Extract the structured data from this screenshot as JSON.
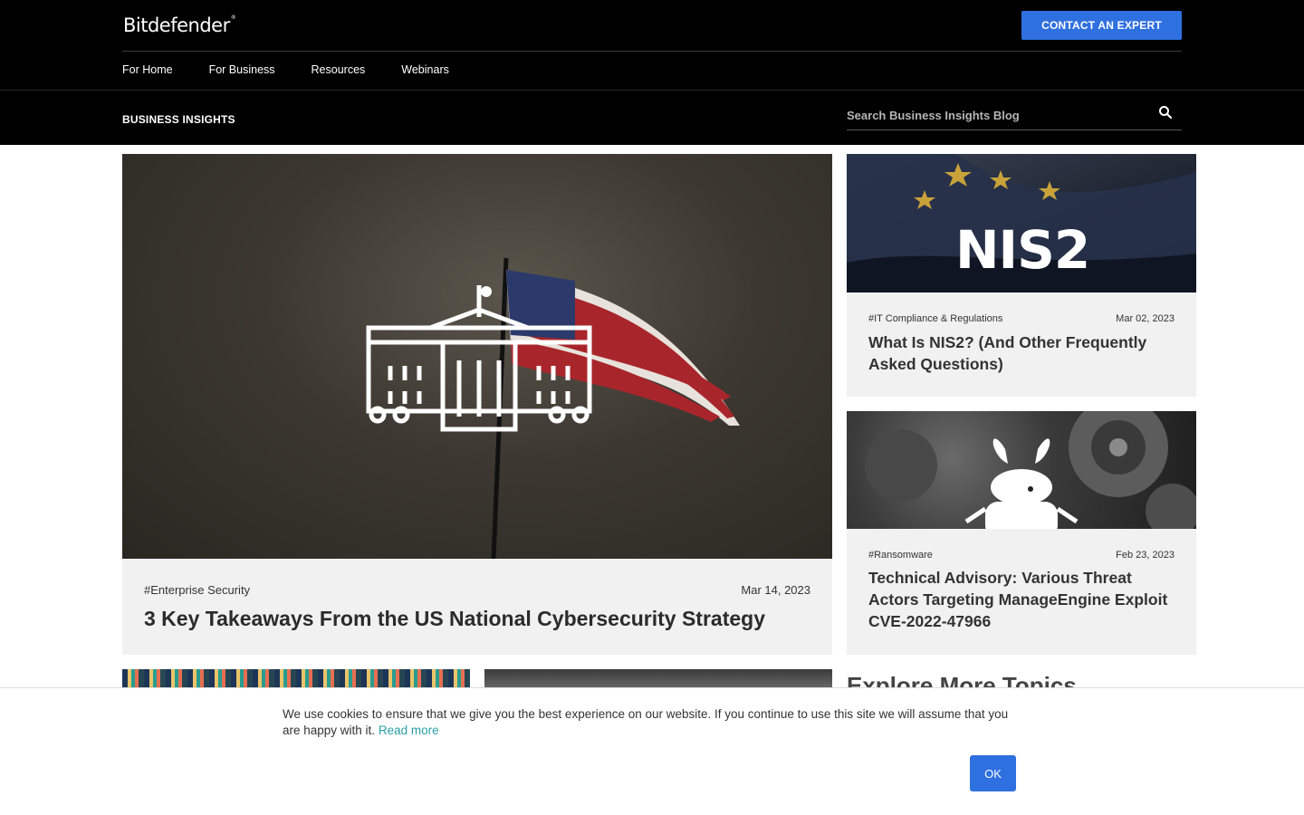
{
  "header": {
    "logo": "Bitdefender",
    "contact_button": "CONTACT AN EXPERT",
    "nav": [
      "For Home",
      "For Business",
      "Resources",
      "Webinars"
    ]
  },
  "subheader": {
    "title": "BUSINESS INSIGHTS",
    "search_placeholder": "Search Business Insights Blog"
  },
  "featured": {
    "tag": "#Enterprise Security",
    "date": "Mar 14, 2023",
    "title": "3 Key Takeaways From the US National Cybersecurity Strategy"
  },
  "cards": [
    {
      "image_text": "NIS2",
      "tag": "#IT Compliance & Regulations",
      "date": "Mar 02, 2023",
      "title": "What Is NIS2? (And Other Frequently Asked Questions)"
    },
    {
      "tag": "#Ransomware",
      "date": "Feb 23, 2023",
      "title": "Technical Advisory: Various Threat Actors Targeting ManageEngine Exploit CVE-2022-47966"
    }
  ],
  "explore": {
    "title": "Explore More Topics"
  },
  "cookie": {
    "text": "We use cookies to ensure that we give you the best experience on our website. If you continue to use this site we will assume that you are happy with it.",
    "link": "Read more",
    "ok": "OK"
  },
  "colors": {
    "accent": "#2f70e0",
    "link": "#2a9fa8",
    "header_bg": "#000000",
    "card_bg": "#f1f1f1"
  }
}
